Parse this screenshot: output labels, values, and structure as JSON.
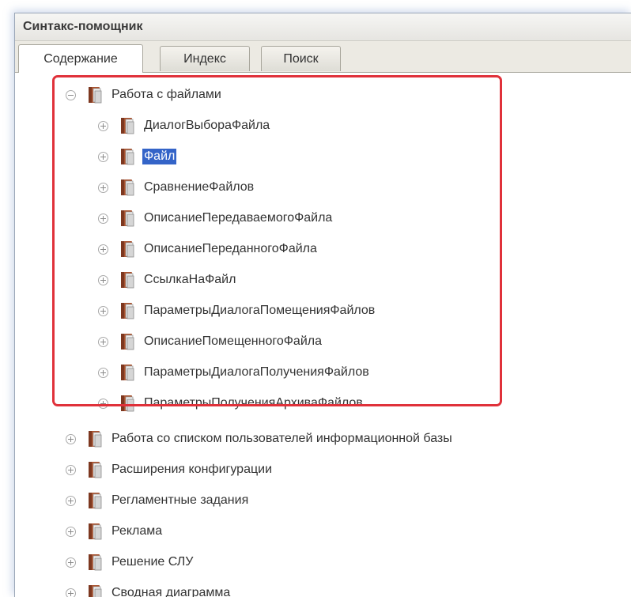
{
  "window": {
    "title": "Синтакс-помощник"
  },
  "tabs": [
    {
      "label": "Содержание",
      "active": true
    },
    {
      "label": "Индекс",
      "active": false
    },
    {
      "label": "Поиск",
      "active": false
    }
  ],
  "tree": {
    "expanded_section": {
      "label": "Работа с файлами",
      "children": [
        {
          "label": "ДиалогВыбораФайла"
        },
        {
          "label": "Файл",
          "selected": true
        },
        {
          "label": "СравнениеФайлов"
        },
        {
          "label": "ОписаниеПередаваемогоФайла"
        },
        {
          "label": "ОписаниеПереданногоФайла"
        },
        {
          "label": "СсылкаНаФайл"
        },
        {
          "label": "ПараметрыДиалогаПомещенияФайлов"
        },
        {
          "label": "ОписаниеПомещенногоФайла"
        },
        {
          "label": "ПараметрыДиалогаПолученияФайлов"
        },
        {
          "label": "ПараметрыПолученияАрхиваФайлов"
        }
      ]
    },
    "sections": [
      {
        "label": "Работа со списком пользователей информационной базы"
      },
      {
        "label": "Расширения конфигурации"
      },
      {
        "label": "Регламентные задания"
      },
      {
        "label": "Реклама"
      },
      {
        "label": "Решение СЛУ"
      },
      {
        "label": "Сводная диаграмма"
      }
    ]
  },
  "colors": {
    "highlight_border": "#e0313a",
    "selection": "#3464c8",
    "book_cover": "#b85a3a"
  },
  "icons": {
    "expanded_toggle": "minus-circle-icon",
    "collapsed_toggle": "plus-circle-icon",
    "node": "book-icon"
  }
}
